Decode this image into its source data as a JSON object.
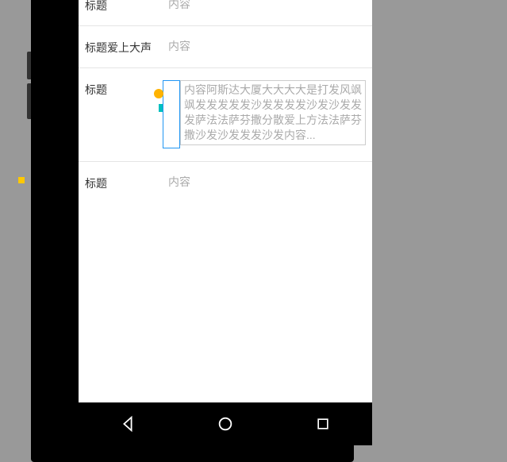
{
  "rows": [
    {
      "label": "标题",
      "content": "内容"
    },
    {
      "label": "标题爱上大声",
      "content": "内容"
    },
    {
      "label": "标题",
      "content": "内容阿斯达大厦大大大大是打发风飒飒发发发发发沙发发发发沙发沙发发发萨法法萨芬撒分散爱上方法法萨芬撒沙发沙发发发沙发内容..."
    },
    {
      "label": "标题",
      "content": "内容"
    }
  ]
}
